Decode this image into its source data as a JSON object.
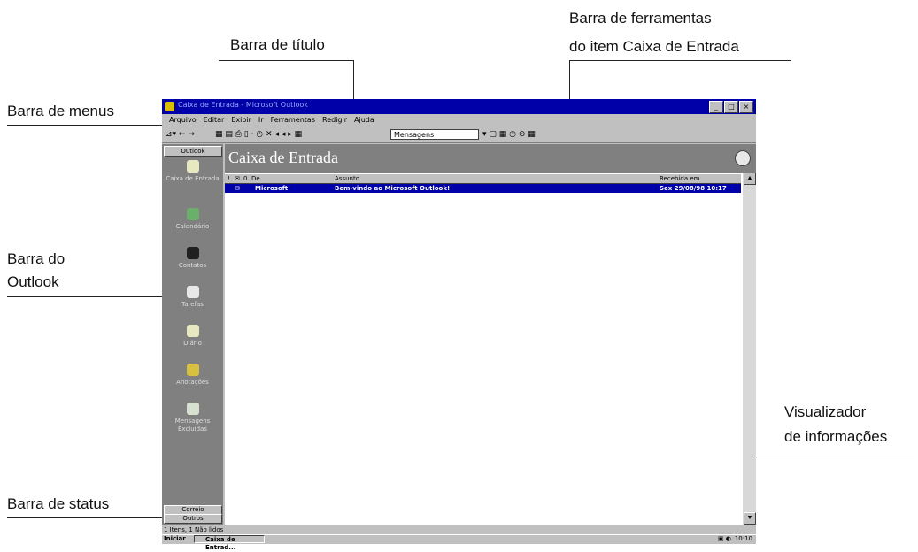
{
  "callouts": {
    "barra_titulo": "Barra de título",
    "barra_ferramentas_1": "Barra de ferramentas",
    "barra_ferramentas_2": "do item Caixa de Entrada",
    "barra_menus": "Barra de menus",
    "barra_outlook_1": "Barra do",
    "barra_outlook_2": "Outlook",
    "visualizador_1": "Visualizador",
    "visualizador_2": "de informações",
    "barra_status": "Barra de status"
  },
  "window": {
    "title": "Caixa de Entrada - Microsoft Outlook",
    "min": "_",
    "max": "□",
    "close": "×"
  },
  "menu": [
    "Arquivo",
    "Editar",
    "Exibir",
    "Ir",
    "Ferramentas",
    "Redigir",
    "Ajuda"
  ],
  "toolbar": {
    "select_value": "Mensagens",
    "left_glyphs": "⊿▾ ← →",
    "mid_glyphs": "▦ ▤  ⎙ ▯  ·  ◴ ✕  ◂ ◂ ▸  ▦",
    "right_glyphs": "▾  ▢ ▦ ◷ ⊙ ▦"
  },
  "outlook_bar": {
    "header": "Outlook",
    "items": [
      {
        "label": "Caixa de Entrada",
        "icon": "inbox-icon",
        "color": "#e8e8c0"
      },
      {
        "label": "Calendário",
        "icon": "calendar-icon",
        "color": "#6ab06a"
      },
      {
        "label": "Contatos",
        "icon": "contacts-icon",
        "color": "#202020"
      },
      {
        "label": "Tarefas",
        "icon": "tasks-icon",
        "color": "#e8e8e8"
      },
      {
        "label": "Diário",
        "icon": "journal-icon",
        "color": "#e8e8c0"
      },
      {
        "label": "Anotações",
        "icon": "notes-icon",
        "color": "#d8c040"
      },
      {
        "label": "Mensagens Excluídas",
        "icon": "deleted-items-icon",
        "color": "#d8e0d0"
      }
    ],
    "bottom_1": "Correio",
    "bottom_2": "Outros"
  },
  "folder": {
    "name": "Caixa de Entrada"
  },
  "columns": {
    "importance": "!",
    "icon": "✉",
    "attach": "0",
    "from": "De",
    "subject": "Assunto",
    "received": "Recebida em"
  },
  "message": {
    "from": "Microsoft",
    "subject": "Bem-vindo ao Microsoft Outlook!",
    "received": "Sex 29/08/98 10:17"
  },
  "status": "1 Itens, 1 Não lidos",
  "taskbar": {
    "start": "Iniciar",
    "item": "Caixa de Entrad...",
    "clock": "10:10"
  },
  "colors": {
    "title_bar": "#0000a8",
    "selection": "#0000a8",
    "window_face": "#c0c0c0",
    "outlook_bar": "#808080"
  }
}
